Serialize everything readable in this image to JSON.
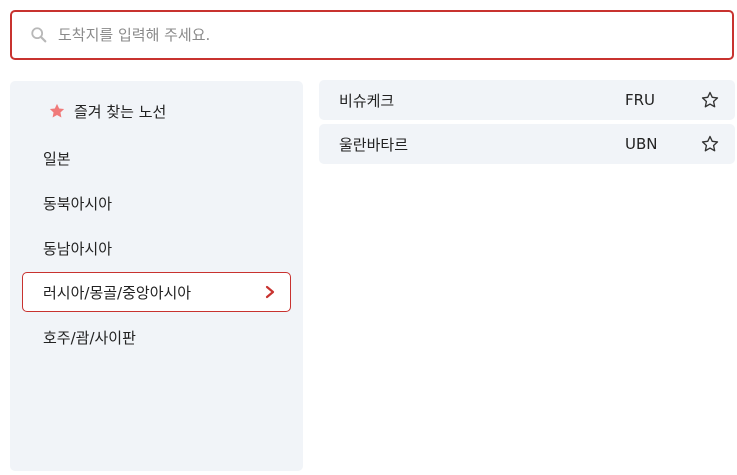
{
  "search": {
    "placeholder": "도착지를 입력해 주세요.",
    "value": ""
  },
  "sidebar": {
    "favorites_label": "즐겨 찾는 노선",
    "items": [
      {
        "label": "일본",
        "active": false
      },
      {
        "label": "동북아시아",
        "active": false
      },
      {
        "label": "동남아시아",
        "active": false
      },
      {
        "label": "러시아/몽골/중앙아시아",
        "active": true
      },
      {
        "label": "호주/괌/사이판",
        "active": false
      }
    ]
  },
  "routes": [
    {
      "name": "비슈케크",
      "code": "FRU",
      "favorite": false
    },
    {
      "name": "울란바타르",
      "code": "UBN",
      "favorite": false
    }
  ],
  "colors": {
    "accent": "#c8322f",
    "favorite_star": "#f07a7a",
    "panel_bg": "#f1f4f8",
    "placeholder": "#8a8a8a"
  },
  "icons": {
    "search": "search-icon",
    "favorites": "star-filled-icon",
    "active_item": "chevron-right-icon",
    "route_favorite": "star-outline-icon"
  }
}
